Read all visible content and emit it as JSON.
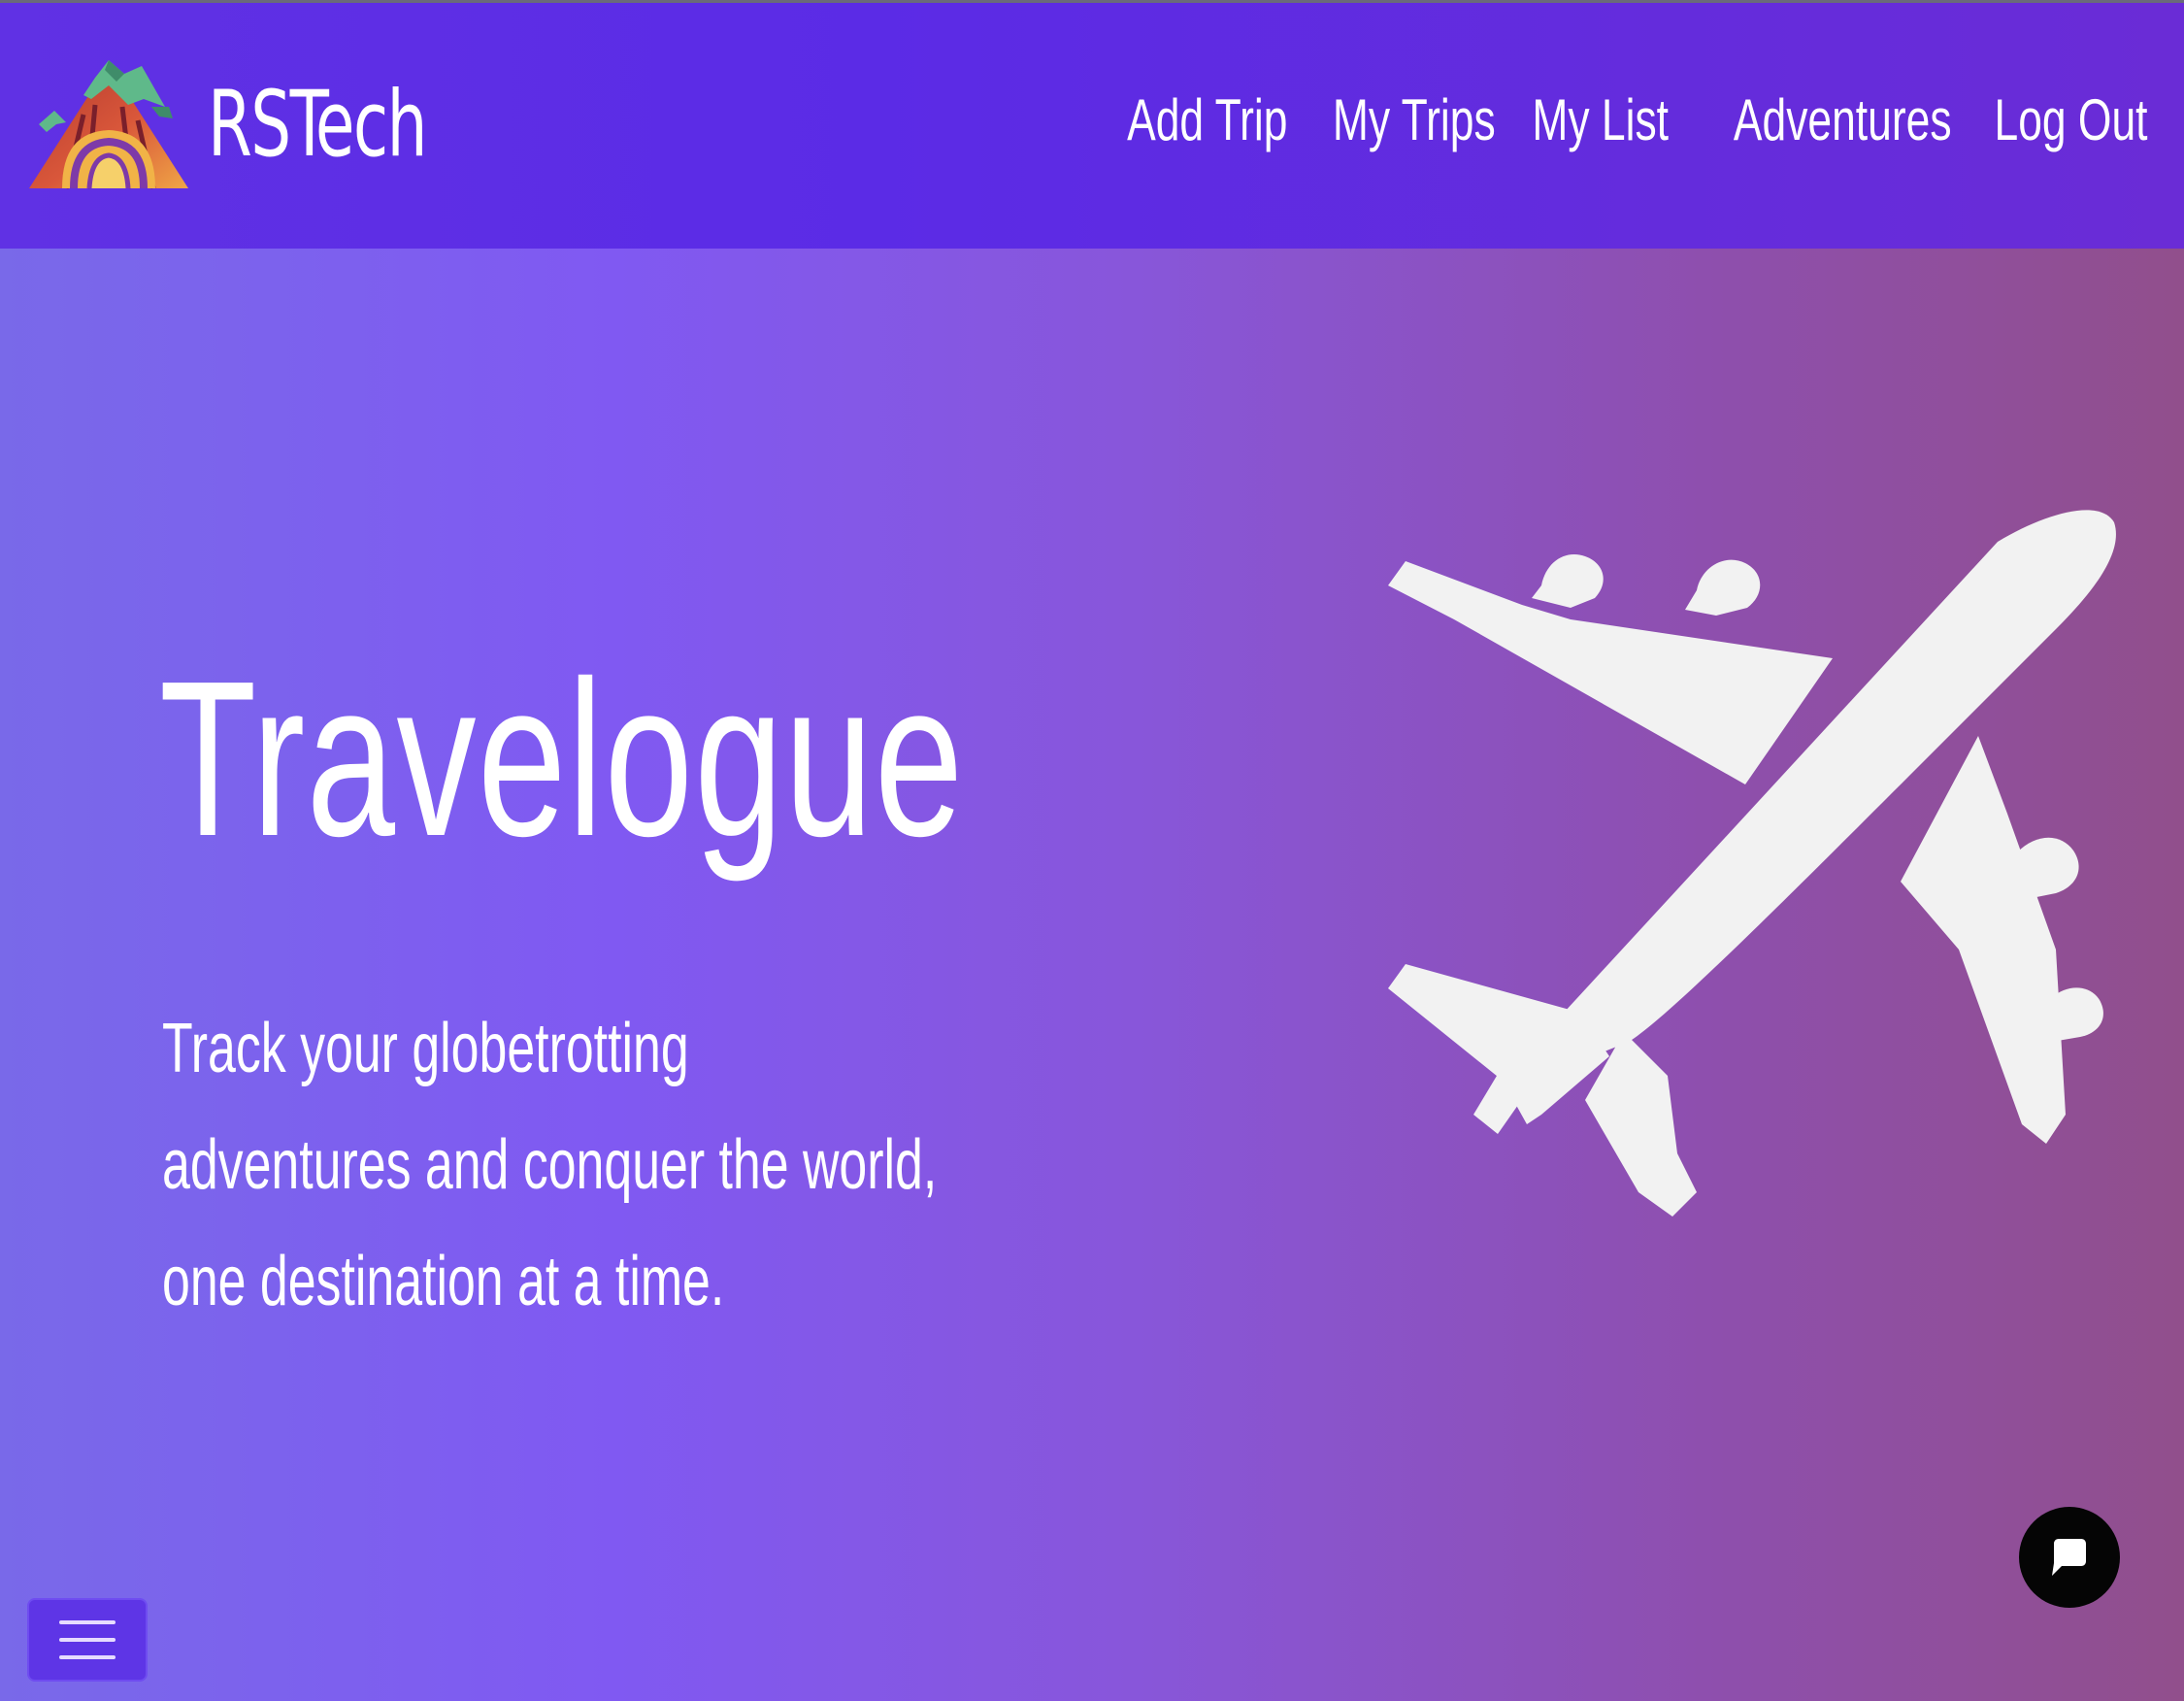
{
  "navbar": {
    "brand_name": "RSTech",
    "logo": "mountain-tunnel-logo",
    "links": [
      {
        "label": "Add Trip"
      },
      {
        "label": "My Trips"
      },
      {
        "label": "My List"
      },
      {
        "label": "Adventures"
      },
      {
        "label": "Log Out"
      }
    ]
  },
  "hero": {
    "title": "Travelogue",
    "subtitle": "Track your globetrotting adventures and conquer the world, one destination at a time.",
    "illustration": "airplane-icon"
  },
  "widgets": {
    "chat_icon": "chat-bubble-icon",
    "menu_icon": "hamburger-menu-icon"
  },
  "colors": {
    "navbar": "#5b2be6",
    "hero_gradient_start": "#7969e9",
    "hero_gradient_end": "#914f8c",
    "text": "#ffffff",
    "plane": "#f2f2f2",
    "chat_button": "#050505"
  }
}
